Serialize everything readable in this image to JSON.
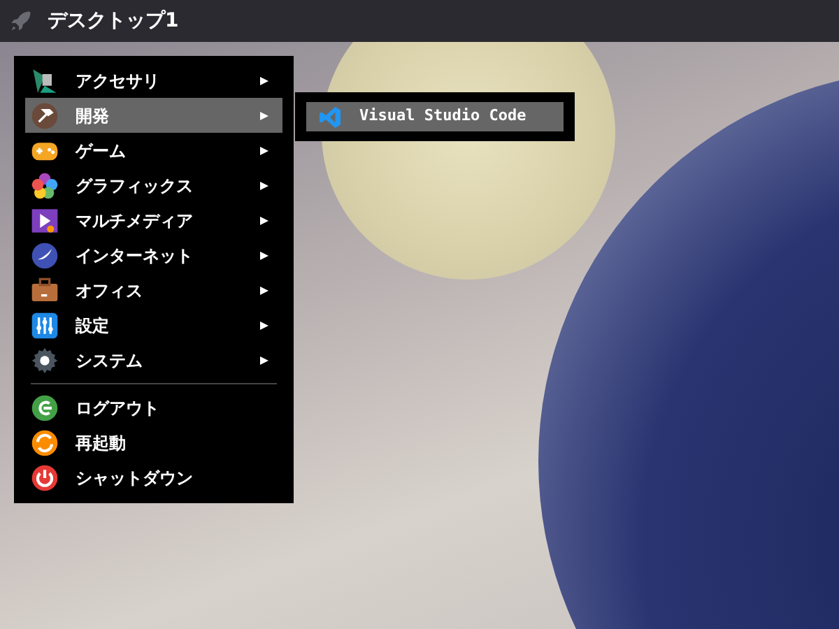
{
  "top_bar": {
    "title": "デスクトップ1"
  },
  "menu": {
    "items": [
      {
        "kind": "entry",
        "label": "アクセサリ",
        "submenu": true,
        "selected": false
      },
      {
        "kind": "entry",
        "label": "開発",
        "submenu": true,
        "selected": true
      },
      {
        "kind": "entry",
        "label": "ゲーム",
        "submenu": true,
        "selected": false
      },
      {
        "kind": "entry",
        "label": "グラフィックス",
        "submenu": true,
        "selected": false
      },
      {
        "kind": "entry",
        "label": "マルチメディア",
        "submenu": true,
        "selected": false
      },
      {
        "kind": "entry",
        "label": "インターネット",
        "submenu": true,
        "selected": false
      },
      {
        "kind": "entry",
        "label": "オフィス",
        "submenu": true,
        "selected": false
      },
      {
        "kind": "entry",
        "label": "設定",
        "submenu": true,
        "selected": false
      },
      {
        "kind": "entry",
        "label": "システム",
        "submenu": true,
        "selected": false
      },
      {
        "kind": "separator"
      },
      {
        "kind": "entry",
        "label": "ログアウト",
        "submenu": false,
        "selected": false
      },
      {
        "kind": "entry",
        "label": "再起動",
        "submenu": false,
        "selected": false
      },
      {
        "kind": "entry",
        "label": "シャットダウン",
        "submenu": false,
        "selected": false
      }
    ]
  },
  "submenu": {
    "items": [
      {
        "label": "Visual Studio Code",
        "selected": true
      }
    ]
  }
}
